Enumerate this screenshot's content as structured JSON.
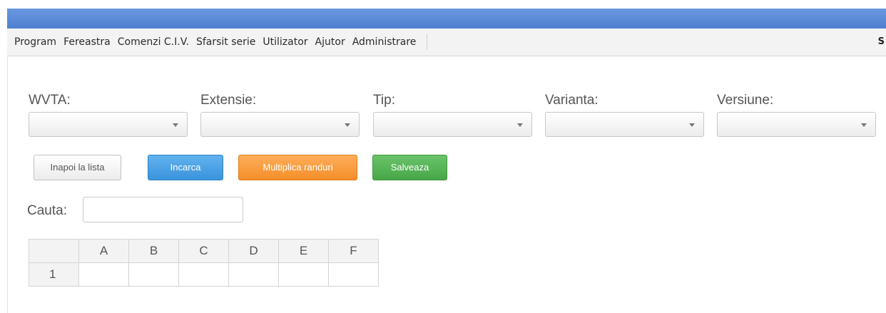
{
  "menu": {
    "items": [
      "Program",
      "Fereastra",
      "Comenzi C.I.V.",
      "Sfarsit serie",
      "Utilizator",
      "Ajutor",
      "Administrare"
    ],
    "right_text": "S"
  },
  "filters": {
    "wvta": {
      "label": "WVTA:",
      "value": ""
    },
    "extensie": {
      "label": "Extensie:",
      "value": ""
    },
    "tip": {
      "label": "Tip:",
      "value": ""
    },
    "varianta": {
      "label": "Varianta:",
      "value": ""
    },
    "versiune": {
      "label": "Versiune:",
      "value": ""
    }
  },
  "buttons": {
    "back": "Inapoi la lista",
    "load": "Incarca",
    "multiply": "Multiplica randuri",
    "save": "Salveaza"
  },
  "search": {
    "label": "Cauta:",
    "value": ""
  },
  "grid": {
    "columns": [
      "A",
      "B",
      "C",
      "D",
      "E",
      "F"
    ],
    "rows": [
      {
        "header": "1",
        "cells": [
          "",
          "",
          "",
          "",
          "",
          ""
        ]
      }
    ]
  },
  "colors": {
    "topbar": "#5a89d6",
    "load_button": "#4aa2e6",
    "multiply_button": "#f79a3b",
    "save_button": "#55b155"
  }
}
